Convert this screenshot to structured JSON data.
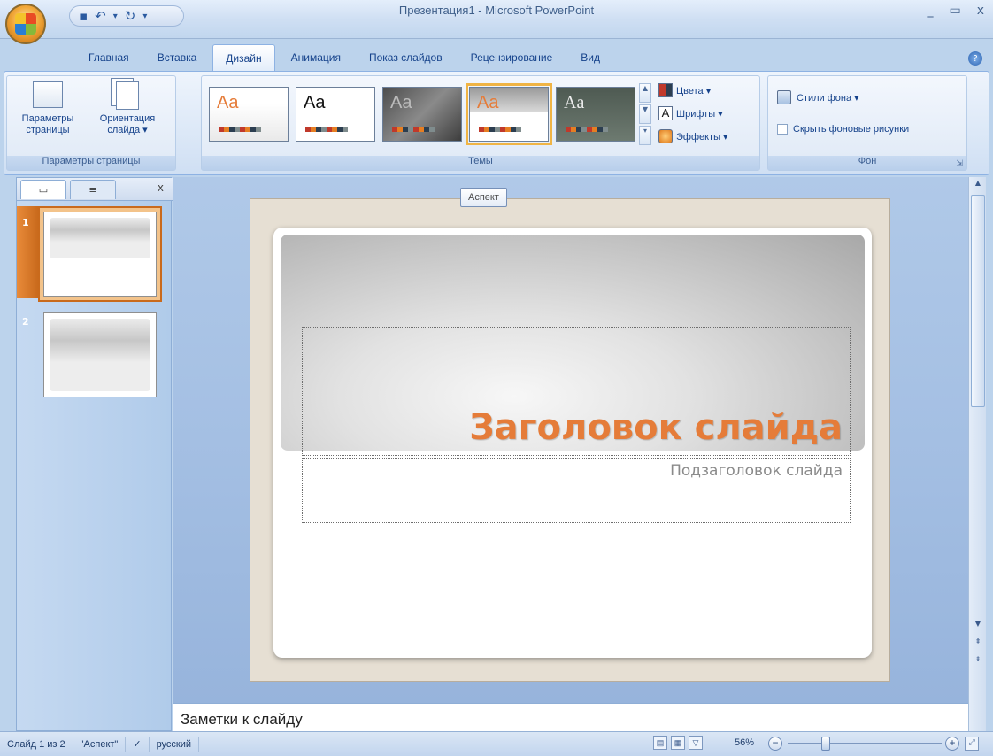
{
  "window": {
    "title": "Презентация1 - Microsoft PowerPoint",
    "controls": [
      "_",
      "▭",
      "x"
    ]
  },
  "quick_access": [
    "save-icon",
    "undo-icon",
    "redo-icon"
  ],
  "tabs": [
    {
      "label": "Главная"
    },
    {
      "label": "Вставка"
    },
    {
      "label": "Дизайн",
      "active": true
    },
    {
      "label": "Анимация"
    },
    {
      "label": "Показ слайдов"
    },
    {
      "label": "Рецензирование"
    },
    {
      "label": "Вид"
    }
  ],
  "ribbon": {
    "page_setup": {
      "label": "Параметры страницы",
      "buttons": [
        {
          "label": "Параметры страницы"
        },
        {
          "label": "Ориентация слайда ▾"
        }
      ]
    },
    "themes": {
      "label": "Темы",
      "thumbs": [
        {
          "text": "Aa"
        },
        {
          "text": "Aa"
        },
        {
          "text": "Aa"
        },
        {
          "text": "Aa"
        },
        {
          "text": "Aa"
        }
      ],
      "colors_label": "Цвета ▾",
      "fonts_label": "Шрифты ▾",
      "effects_label": "Эффекты ▾"
    },
    "background": {
      "label": "Фон",
      "styles_label": "Стили фона ▾",
      "hide_label": "Скрыть фоновые рисунки"
    }
  },
  "tooltip": "Аспект",
  "slide": {
    "title": "Заголовок слайда",
    "subtitle": "Подзаголовок слайда"
  },
  "slides_pane": {
    "slide_numbers": [
      "1",
      "2"
    ]
  },
  "notes_placeholder": "Заметки к слайду",
  "status": {
    "slide_info": "Слайд 1 из 2",
    "theme_name": "\"Аспект\"",
    "language": "русский",
    "zoom": "56%"
  },
  "colors": {
    "accent": "#e57c39",
    "ribbon": "#dce8f7"
  }
}
